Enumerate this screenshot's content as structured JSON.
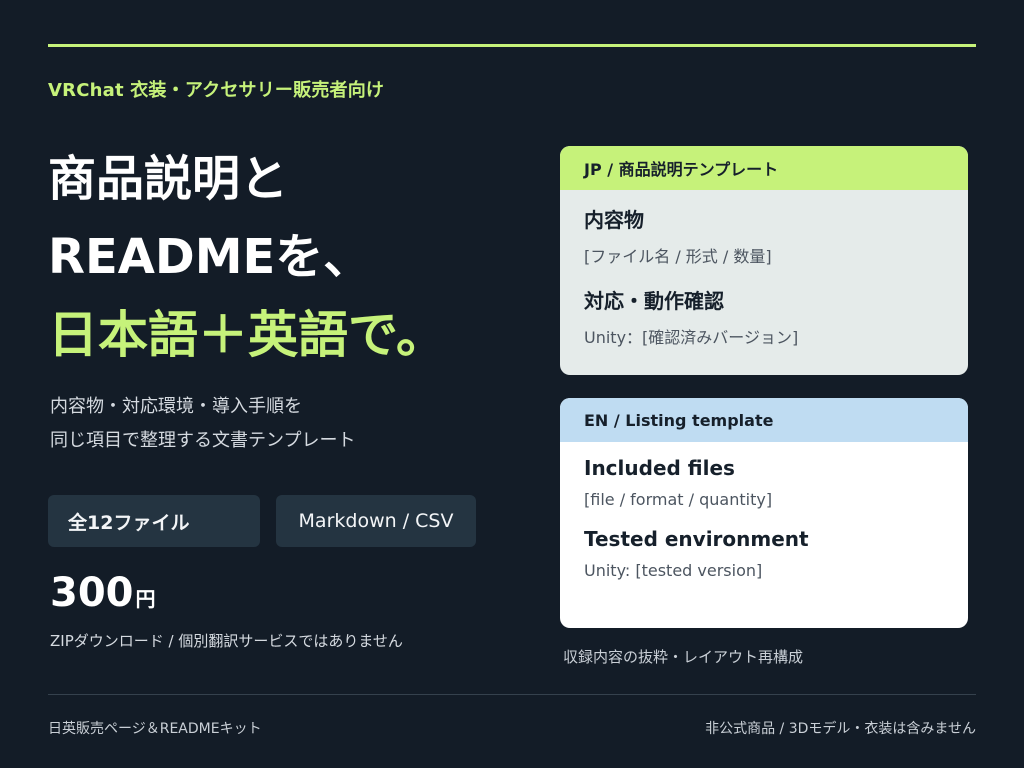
{
  "eyebrow": "VRChat 衣装・アクセサリー販売者向け",
  "headline": {
    "line1": "商品説明と",
    "line2": "READMEを、",
    "line3": "日本語＋英語で。"
  },
  "subcopy": {
    "line1": "内容物・対応環境・導入手順を",
    "line2": "同じ項目で整理する文書テンプレート"
  },
  "pills": {
    "files": "全12ファイル",
    "formats": "Markdown / CSV"
  },
  "price": {
    "amount": "300",
    "unit": "円",
    "note": "ZIPダウンロード / 個別翻訳サービスではありません"
  },
  "card_jp": {
    "header": "JP / 商品説明テンプレート",
    "field1_title": "内容物",
    "field1_value": "[ファイル名 / 形式 / 数量]",
    "field2_title": "対応・動作確認",
    "field2_value": "Unity：[確認済みバージョン]"
  },
  "card_en": {
    "header": "EN / Listing template",
    "field1_title": "Included files",
    "field1_value": "[file / format / quantity]",
    "field2_title": "Tested environment",
    "field2_value": "Unity: [tested version]"
  },
  "card_note": "収録内容の抜粋・レイアウト再構成",
  "footer": {
    "left": "日英販売ページ＆READMEキット",
    "right": "非公式商品 / 3Dモデル・衣装は含みません"
  },
  "colors": {
    "background": "#131c27",
    "accent": "#c6f27a",
    "jp_card_header": "#c6f27a",
    "en_card_header": "#bfdcf2"
  }
}
